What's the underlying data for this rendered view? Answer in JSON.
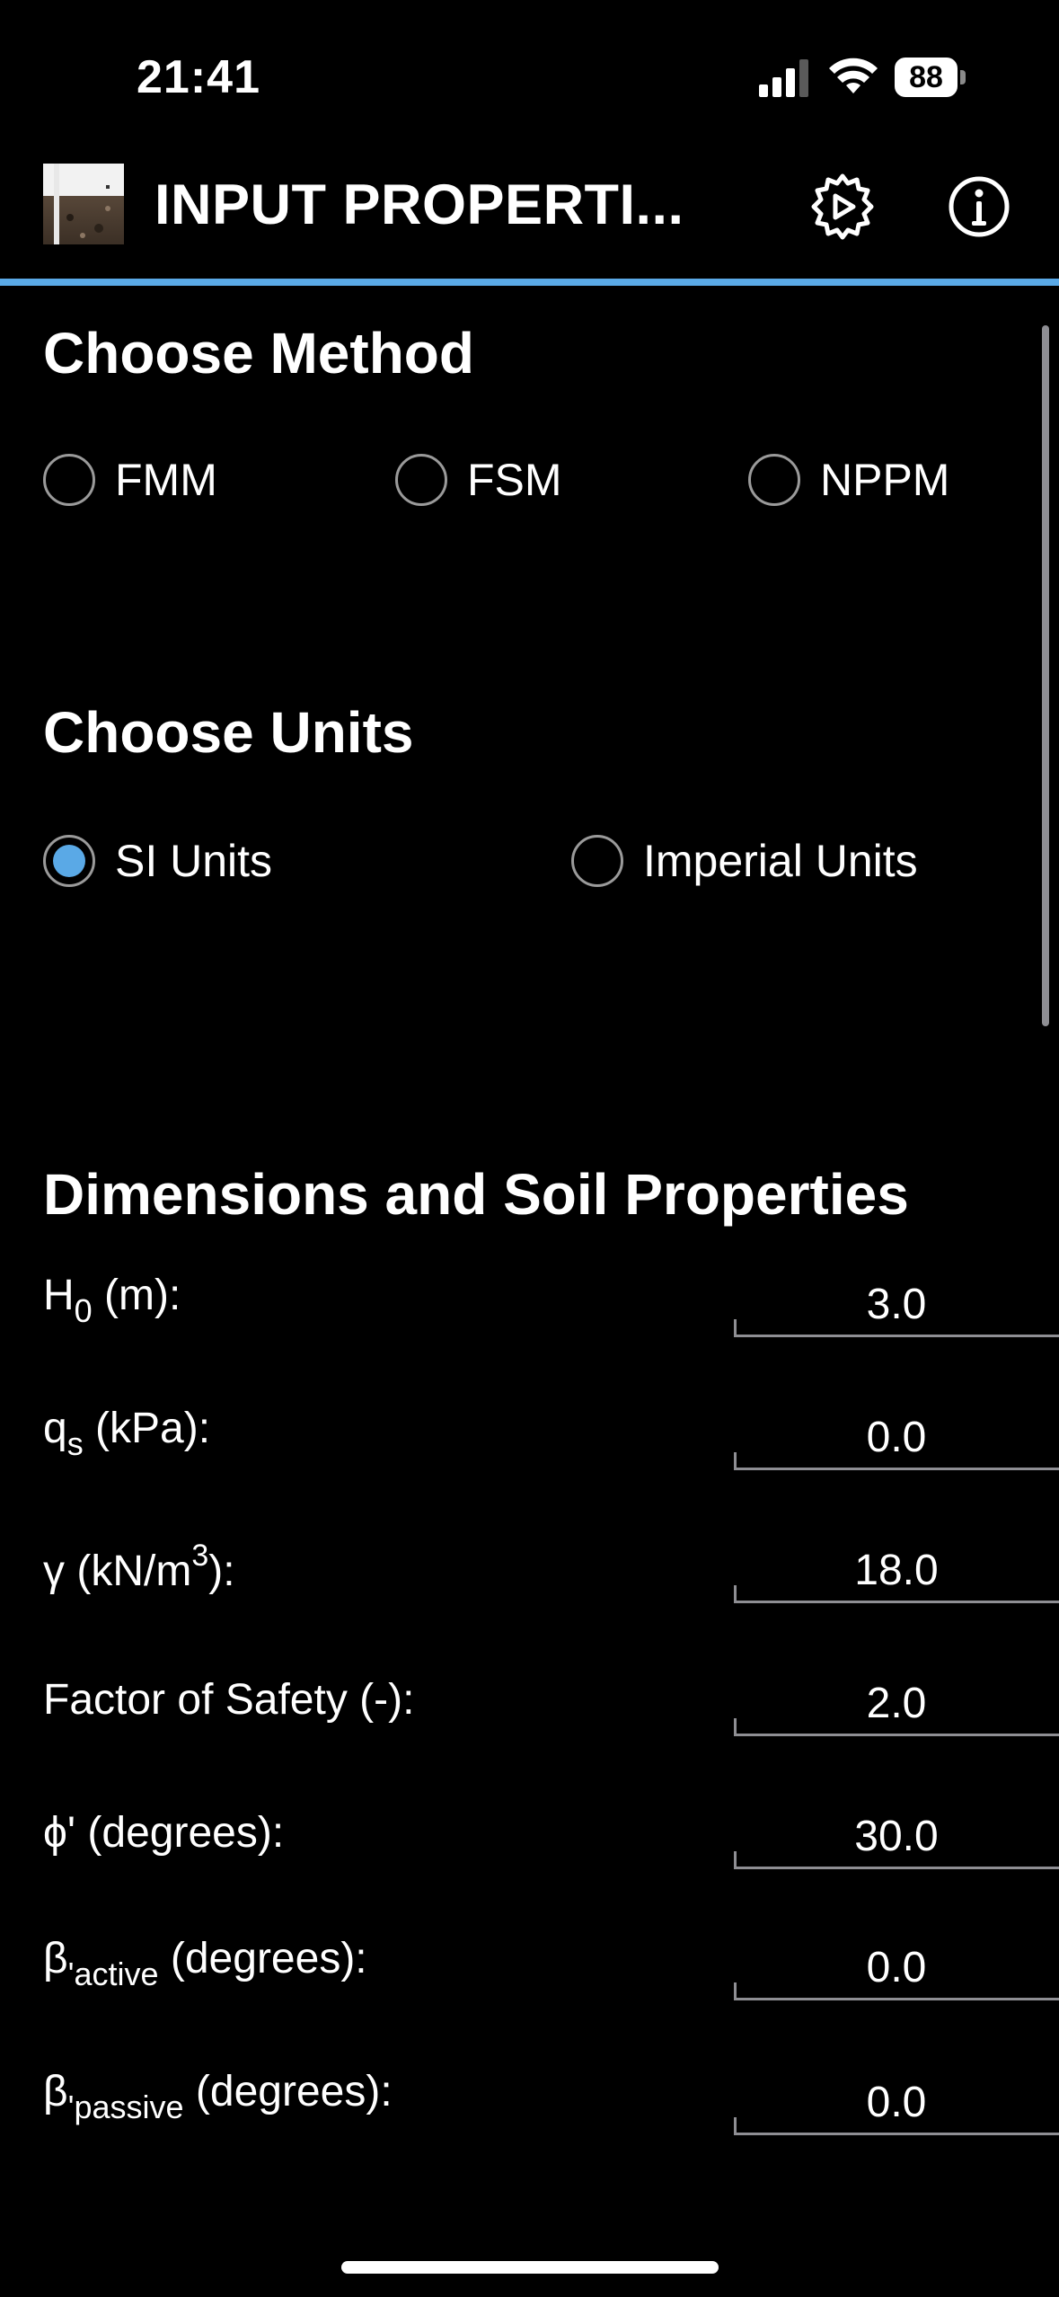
{
  "status_bar": {
    "time": "21:41",
    "battery": "88"
  },
  "app_bar": {
    "title": "INPUT PROPERTI..."
  },
  "method": {
    "title": "Choose Method",
    "options": [
      {
        "label": "FMM",
        "selected": false
      },
      {
        "label": "FSM",
        "selected": false
      },
      {
        "label": "NPPM",
        "selected": false
      }
    ]
  },
  "units": {
    "title": "Choose Units",
    "options": [
      {
        "label": "SI Units",
        "selected": true
      },
      {
        "label": "Imperial Units",
        "selected": false
      }
    ]
  },
  "properties": {
    "title": "Dimensions and Soil Properties",
    "fields": [
      {
        "base": "H",
        "sub": "0",
        "sup": "",
        "tail": " (m):",
        "value": "3.0"
      },
      {
        "base": "q",
        "sub": "s",
        "sup": "",
        "tail": " (kPa):",
        "value": "0.0"
      },
      {
        "base": "γ (kN/m",
        "sub": "",
        "sup": "3",
        "tail": "):",
        "value": "18.0"
      },
      {
        "base": "Factor of Safety (-):",
        "sub": "",
        "sup": "",
        "tail": "",
        "value": "2.0"
      },
      {
        "base": "ϕ' (degrees):",
        "sub": "",
        "sup": "",
        "tail": "",
        "value": "30.0"
      },
      {
        "base": "β",
        "sub": "'active",
        "sup": "",
        "tail": " (degrees):",
        "value": "0.0"
      },
      {
        "base": "β",
        "sub": "'passive",
        "sup": "",
        "tail": " (degrees):",
        "value": "0.0"
      }
    ]
  },
  "colors": {
    "accent": "#5aa9e6",
    "background": "#000000",
    "divider": "#8e8e93"
  }
}
